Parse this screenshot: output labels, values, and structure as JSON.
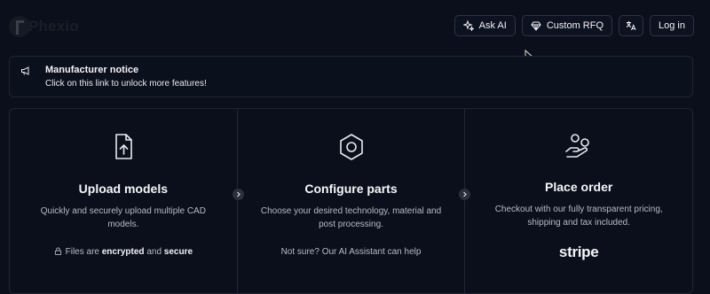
{
  "brand": {
    "name": "Phexio"
  },
  "header": {
    "ask_ai": "Ask AI",
    "custom_rfq": "Custom RFQ",
    "translate_icon": "translate-icon",
    "login": "Log in"
  },
  "notice": {
    "title": "Manufacturer notice",
    "body": "Click on this link to unlock more features!"
  },
  "steps": [
    {
      "icon": "file-upload-icon",
      "title": "Upload models",
      "description": "Quickly and securely upload multiple CAD models.",
      "footer_prefix": "Files are ",
      "footer_bold1": "encrypted",
      "footer_mid": " and ",
      "footer_bold2": "secure"
    },
    {
      "icon": "hexagon-nut-icon",
      "title": "Configure parts",
      "description": "Choose your desired technology, material and post processing.",
      "footer": "Not sure? Our AI Assistant can help"
    },
    {
      "icon": "hand-coins-icon",
      "title": "Place order",
      "description": "Checkout with our fully transparent pricing, shipping and tax included.",
      "footer": "stripe"
    }
  ]
}
